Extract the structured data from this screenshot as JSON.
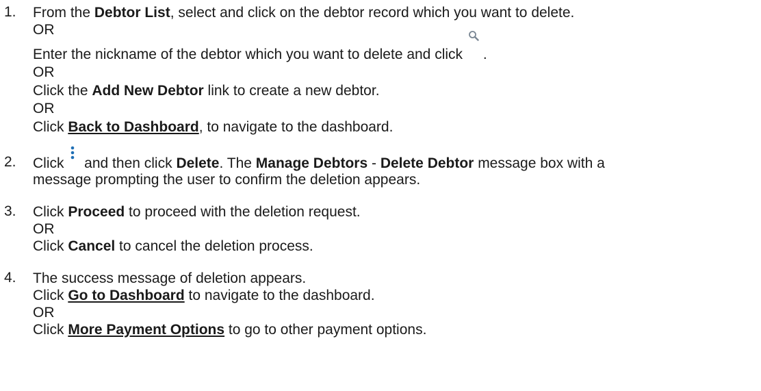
{
  "steps": [
    {
      "number": "1.",
      "lines": [
        {
          "t1": "From the ",
          "b1": "Debtor List",
          "t2": ", select and click on the debtor record which you want to delete."
        },
        {
          "t1": "OR"
        },
        {
          "t1": "Enter the nickname of the debtor which you want to delete and click ",
          "t2": "."
        },
        {
          "t1": "OR"
        },
        {
          "t1": "Click the ",
          "b1": "Add New Debtor",
          "t2": " link to create a new debtor."
        },
        {
          "t1": "OR"
        },
        {
          "t1": "Click ",
          "b1": "Back to Dashboard",
          "t2": ", to navigate to the dashboard."
        }
      ]
    },
    {
      "number": "2.",
      "lines": [
        {
          "t1": "Click ",
          "t2": " and then click ",
          "b1": "Delete",
          "t3": ". The ",
          "b2": "Manage Debtors",
          "t4": " - ",
          "b3": "Delete Debtor",
          "t5": " message box with a"
        },
        {
          "t1": "message prompting the user to confirm the deletion appears."
        }
      ]
    },
    {
      "number": "3.",
      "lines": [
        {
          "t1": "Click ",
          "b1": "Proceed",
          "t2": " to proceed with the deletion request."
        },
        {
          "t1": "OR"
        },
        {
          "t1": "Click ",
          "b1": "Cancel",
          "t2": " to cancel the deletion process."
        }
      ]
    },
    {
      "number": "4.",
      "lines": [
        {
          "t1": "The success message of deletion appears."
        },
        {
          "t1": "Click ",
          "b1": "Go to Dashboard",
          "t2": " to navigate to the dashboard."
        },
        {
          "t1": "OR"
        },
        {
          "t1": "Click ",
          "b1": "More Payment Options",
          "t2": " to go to other payment options."
        }
      ]
    }
  ],
  "icons": {
    "search": "search-icon",
    "more": "kebab-menu-icon",
    "search_color": "#7a8794",
    "kebab_color": "#1f6fb5"
  }
}
